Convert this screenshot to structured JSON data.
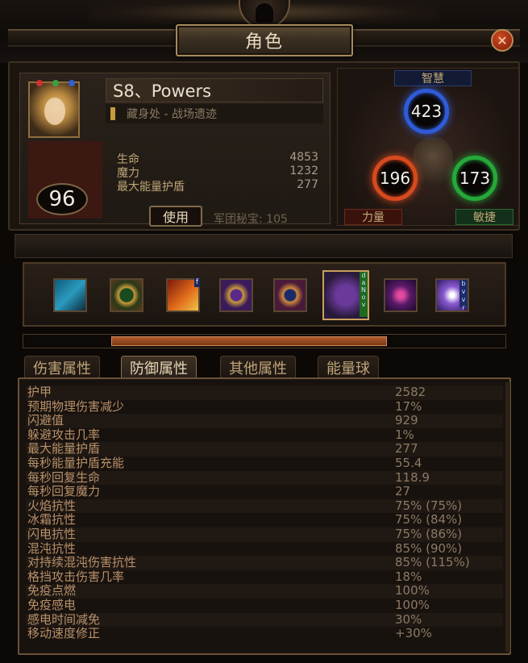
{
  "window": {
    "title": "角色"
  },
  "character": {
    "name": "S8、Powers",
    "location": "藏身处 - 战场遗迹",
    "level": "96",
    "resources": [
      {
        "label": "生命",
        "value": "4853"
      },
      {
        "label": "魔力",
        "value": "1232"
      },
      {
        "label": "最大能量护盾",
        "value": "277"
      }
    ],
    "use_button": "使用",
    "legion_text": "军团秘宝: 105"
  },
  "attributes": {
    "intelligence": {
      "label": "智慧",
      "value": "423",
      "color": "#2f5bd6"
    },
    "strength": {
      "label": "力量",
      "value": "196",
      "color": "#d64a1e"
    },
    "dexterity": {
      "label": "敏捷",
      "value": "173",
      "color": "#26a83a"
    }
  },
  "skills": [
    {
      "icon": "skill-water-icon"
    },
    {
      "icon": "skill-green-ring-icon"
    },
    {
      "icon": "skill-fire-runner-icon",
      "badge": "f"
    },
    {
      "icon": "skill-purple-rune-icon"
    },
    {
      "icon": "skill-chaos-rune-icon"
    },
    {
      "icon": "skill-selected-rune-icon",
      "badge": "d a N o v",
      "selected": true
    },
    {
      "icon": "skill-pink-wave-icon"
    },
    {
      "icon": "skill-frost-leaf-icon",
      "badge": "b v v r"
    }
  ],
  "scrollbar": {
    "position": 0.43
  },
  "tabs": [
    {
      "label": "伤害属性",
      "active": false
    },
    {
      "label": "防御属性",
      "active": true
    },
    {
      "label": "其他属性",
      "active": false
    },
    {
      "label": "能量球",
      "active": false
    }
  ],
  "stats": [
    {
      "label": "护甲",
      "value": "2582"
    },
    {
      "label": "预期物理伤害减少",
      "value": "17%"
    },
    {
      "label": "闪避值",
      "value": "929"
    },
    {
      "label": "躲避攻击几率",
      "value": "1%"
    },
    {
      "label": "最大能量护盾",
      "value": "277"
    },
    {
      "label": "每秒能量护盾充能",
      "value": "55.4"
    },
    {
      "label": "每秒回复生命",
      "value": "118.9"
    },
    {
      "label": "每秒回复魔力",
      "value": "27"
    },
    {
      "label": "火焰抗性",
      "value": "75% (75%)"
    },
    {
      "label": "冰霜抗性",
      "value": "75% (84%)"
    },
    {
      "label": "闪电抗性",
      "value": "75% (86%)"
    },
    {
      "label": "混沌抗性",
      "value": "85% (90%)"
    },
    {
      "label": "对持续混沌伤害抗性",
      "value": "85% (115%)"
    },
    {
      "label": "格挡攻击伤害几率",
      "value": "18%"
    },
    {
      "label": "免疫点燃",
      "value": "100%"
    },
    {
      "label": "免疫感电",
      "value": "100%"
    },
    {
      "label": "感电时间减免",
      "value": "30%"
    },
    {
      "label": "移动速度修正",
      "value": "+30%"
    }
  ]
}
